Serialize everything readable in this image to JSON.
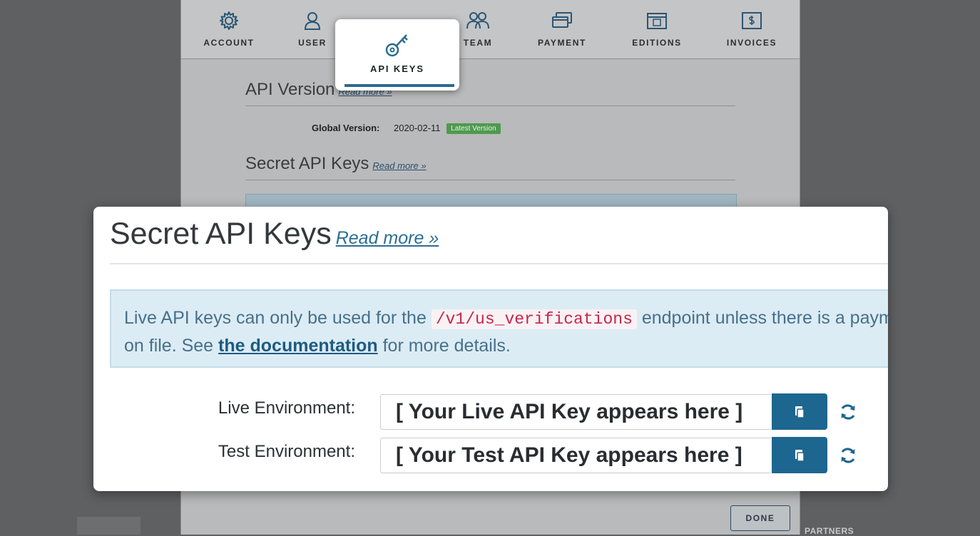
{
  "nav": {
    "items": [
      {
        "label": "ACCOUNT",
        "icon": "gear-icon"
      },
      {
        "label": "USER",
        "icon": "user-icon"
      },
      {
        "label": "API KEYS",
        "icon": "key-icon"
      },
      {
        "label": "TEAM",
        "icon": "team-icon"
      },
      {
        "label": "PAYMENT",
        "icon": "credit-card-icon"
      },
      {
        "label": "EDITIONS",
        "icon": "calendar-icon"
      },
      {
        "label": "INVOICES",
        "icon": "invoice-icon"
      }
    ],
    "active": "API KEYS"
  },
  "api_version": {
    "heading": "API Version",
    "read_more": "Read more »",
    "global_version_label": "Global Version:",
    "global_version_value": "2020-02-11",
    "badge": "Latest Version"
  },
  "secret_keys": {
    "heading": "Secret API Keys",
    "read_more": "Read more »",
    "notice_prefix": "Live API keys can only be used for the",
    "notice_code": "/v1/us_verifications",
    "notice_mid": "endpoint unless there is a payme",
    "notice_line2_prefix": "on file. See",
    "notice_link": "the documentation",
    "notice_suffix": "for more details.",
    "live_label": "Live Environment:",
    "live_value": "[ Your Live API Key appears here ]",
    "test_label": "Test Environment:",
    "test_value": "[ Your Test API Key appears here ]"
  },
  "footer": {
    "done_label": "DONE",
    "partners_label": "PARTNERS"
  },
  "colors": {
    "accent": "#1d6690",
    "badge_green": "#4e9a50",
    "code_red": "#c7254e",
    "notice_bg": "#dcecf5"
  }
}
